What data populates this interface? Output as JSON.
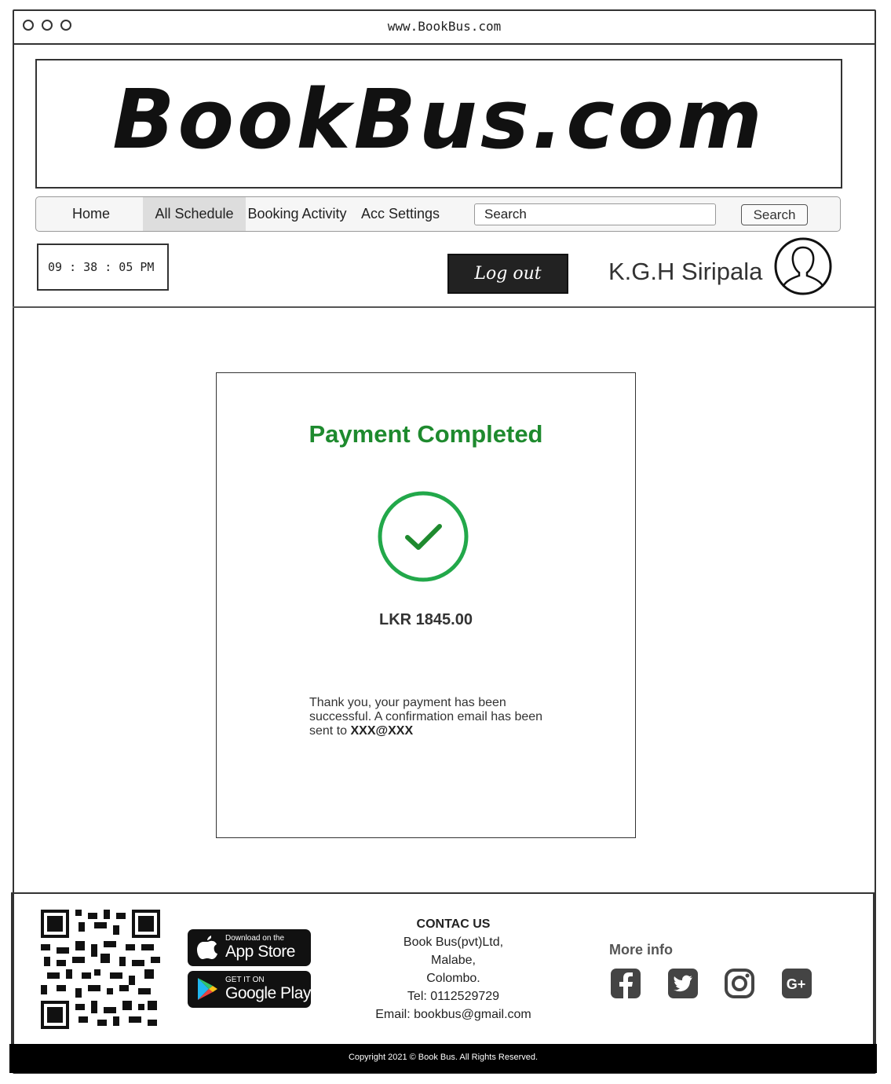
{
  "browser": {
    "url": "www.BookBus.com"
  },
  "header": {
    "logo_text": "BookBus.com"
  },
  "nav": {
    "items": [
      "Home",
      "All Schedule",
      "Booking Activity",
      "Acc Settings"
    ],
    "active_index": 1,
    "search_value": "Search",
    "search_button": "Search"
  },
  "user_bar": {
    "clock": "09 : 38 : 05 PM",
    "logout_label": "Log out",
    "username": "K.G.H Siripala"
  },
  "payment": {
    "title": "Payment Completed",
    "amount": "LKR 1845.00",
    "message_prefix": "Thank you, your payment has been successful. A confirmation email has been sent to ",
    "email": "XXX@XXX",
    "accent_color": "#1e8a2e",
    "check_color": "#22a84a"
  },
  "footer": {
    "app_store": {
      "small": "Download on the",
      "big": "App Store"
    },
    "google_play": {
      "small": "GET IT ON",
      "big": "Google Play"
    },
    "contact": {
      "heading": "CONTAC US",
      "lines": [
        "Book Bus(pvt)Ltd,",
        "Malabe,",
        "Colombo.",
        "Tel: 0112529729",
        "Email: bookbus@gmail.com"
      ]
    },
    "more_info": "More info",
    "social_icons": [
      "facebook-icon",
      "twitter-icon",
      "instagram-icon",
      "google-plus-icon"
    ],
    "copyright": "Copyright 2021 © Book Bus. All Rights Reserved."
  }
}
